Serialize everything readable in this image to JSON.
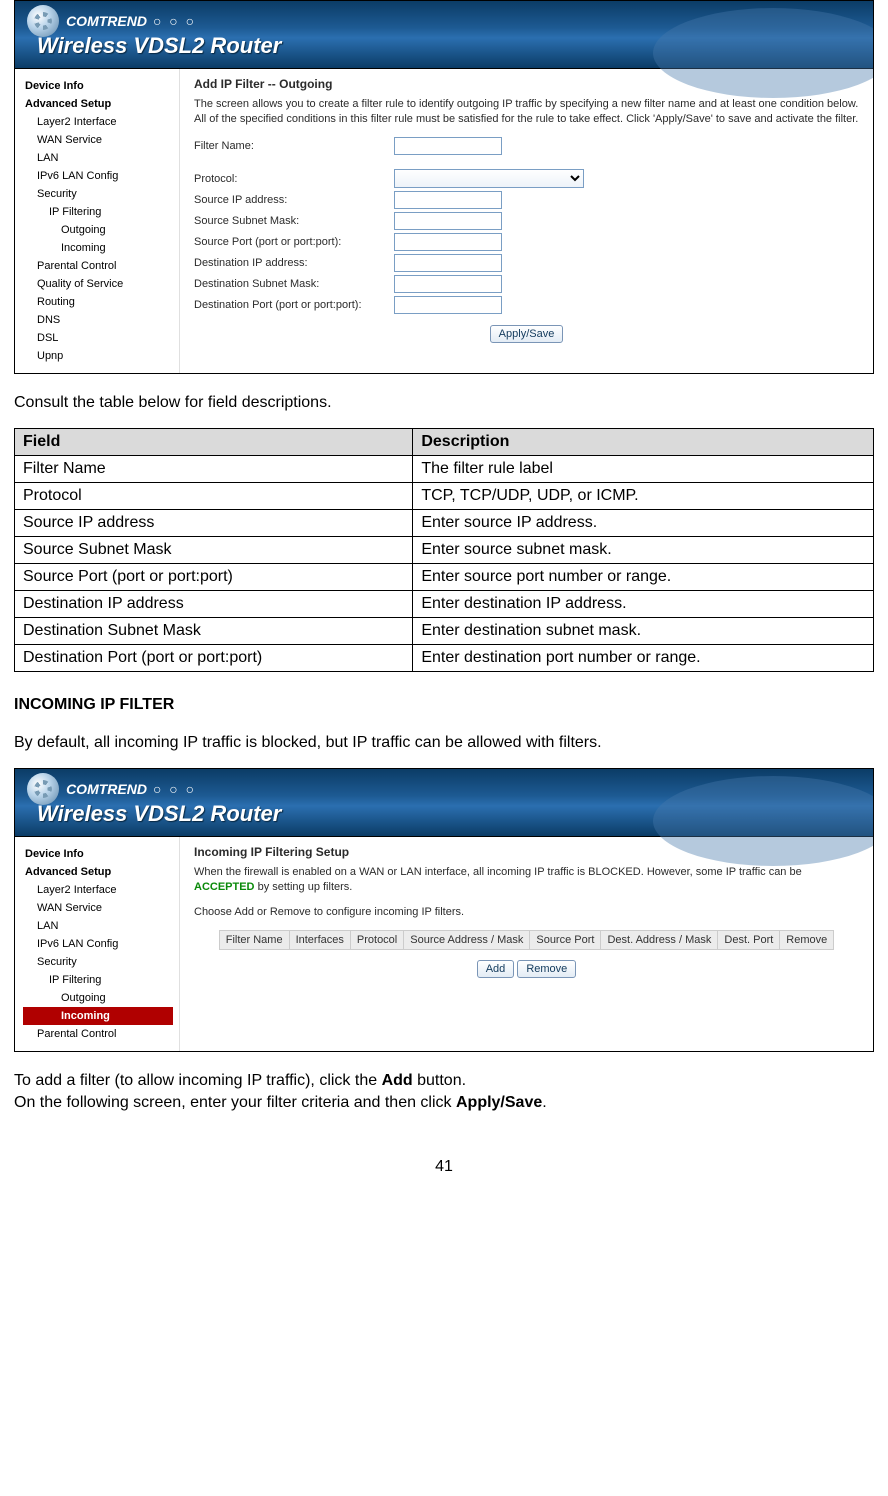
{
  "branding": {
    "brand": "COMTREND",
    "dots": "○ ○ ○",
    "product": "Wireless VDSL2 Router"
  },
  "shot1": {
    "nav": {
      "deviceInfo": "Device Info",
      "advancedSetup": "Advanced Setup",
      "layer2": "Layer2 Interface",
      "wan": "WAN Service",
      "lan": "LAN",
      "ipv6lan": "IPv6 LAN Config",
      "security": "Security",
      "ipFiltering": "IP Filtering",
      "outgoing": "Outgoing",
      "incoming": "Incoming",
      "parental": "Parental Control",
      "qos": "Quality of Service",
      "routing": "Routing",
      "dns": "DNS",
      "dsl": "DSL",
      "upnp": "Upnp"
    },
    "title": "Add IP Filter -- Outgoing",
    "intro": "The screen allows you to create a filter rule to identify outgoing IP traffic by specifying a new filter name and at least one condition below. All of the specified conditions in this filter rule must be satisfied for the rule to take effect. Click 'Apply/Save' to save and activate the filter.",
    "fields": {
      "filterName": "Filter Name:",
      "protocol": "Protocol:",
      "srcIp": "Source IP address:",
      "srcMask": "Source Subnet Mask:",
      "srcPort": "Source Port (port or port:port):",
      "dstIp": "Destination IP address:",
      "dstMask": "Destination Subnet Mask:",
      "dstPort": "Destination Port (port or port:port):"
    },
    "applyBtn": "Apply/Save"
  },
  "doc": {
    "tableLead": "Consult the table below for field descriptions.",
    "headers": {
      "field": "Field",
      "desc": "Description"
    },
    "rows": [
      {
        "f": "Filter Name",
        "d": "The filter rule label"
      },
      {
        "f": "Protocol",
        "d": "TCP, TCP/UDP, UDP, or ICMP."
      },
      {
        "f": "Source IP address",
        "d": "Enter source IP address."
      },
      {
        "f": "Source Subnet Mask",
        "d": "Enter source subnet mask."
      },
      {
        "f": "Source Port (port or port:port)",
        "d": "Enter source port number or range."
      },
      {
        "f": "Destination IP address",
        "d": "Enter destination IP address."
      },
      {
        "f": "Destination Subnet Mask",
        "d": "Enter destination subnet mask."
      },
      {
        "f": "Destination Port (port or port:port)",
        "d": "Enter destination port number or range."
      }
    ],
    "section2": "INCOMING IP FILTER",
    "para2": "By default, all incoming IP traffic is blocked, but IP traffic can be allowed with filters.",
    "afterShot2a_pre": "To add a filter (to allow incoming IP traffic), click the ",
    "afterShot2a_b": "Add",
    "afterShot2a_post": " button.",
    "afterShot2b_pre": "On the following screen, enter your filter criteria and then click ",
    "afterShot2b_b": "Apply/Save",
    "afterShot2b_post": ".",
    "pageNum": "41"
  },
  "shot2": {
    "nav": {
      "deviceInfo": "Device Info",
      "advancedSetup": "Advanced Setup",
      "layer2": "Layer2 Interface",
      "wan": "WAN Service",
      "lan": "LAN",
      "ipv6lan": "IPv6 LAN Config",
      "security": "Security",
      "ipFiltering": "IP Filtering",
      "outgoing": "Outgoing",
      "incoming": "Incoming",
      "parental": "Parental Control"
    },
    "title": "Incoming IP Filtering Setup",
    "intro_pre": "When the firewall is enabled on a WAN or LAN interface, all incoming IP traffic is BLOCKED. However, some IP traffic can be ",
    "intro_acc": "ACCEPTED",
    "intro_post": " by setting up filters.",
    "choose": "Choose Add or Remove to configure incoming IP filters.",
    "cols": {
      "c1": "Filter Name",
      "c2": "Interfaces",
      "c3": "Protocol",
      "c4": "Source Address / Mask",
      "c5": "Source Port",
      "c6": "Dest. Address / Mask",
      "c7": "Dest. Port",
      "c8": "Remove"
    },
    "addBtn": "Add",
    "removeBtn": "Remove"
  }
}
